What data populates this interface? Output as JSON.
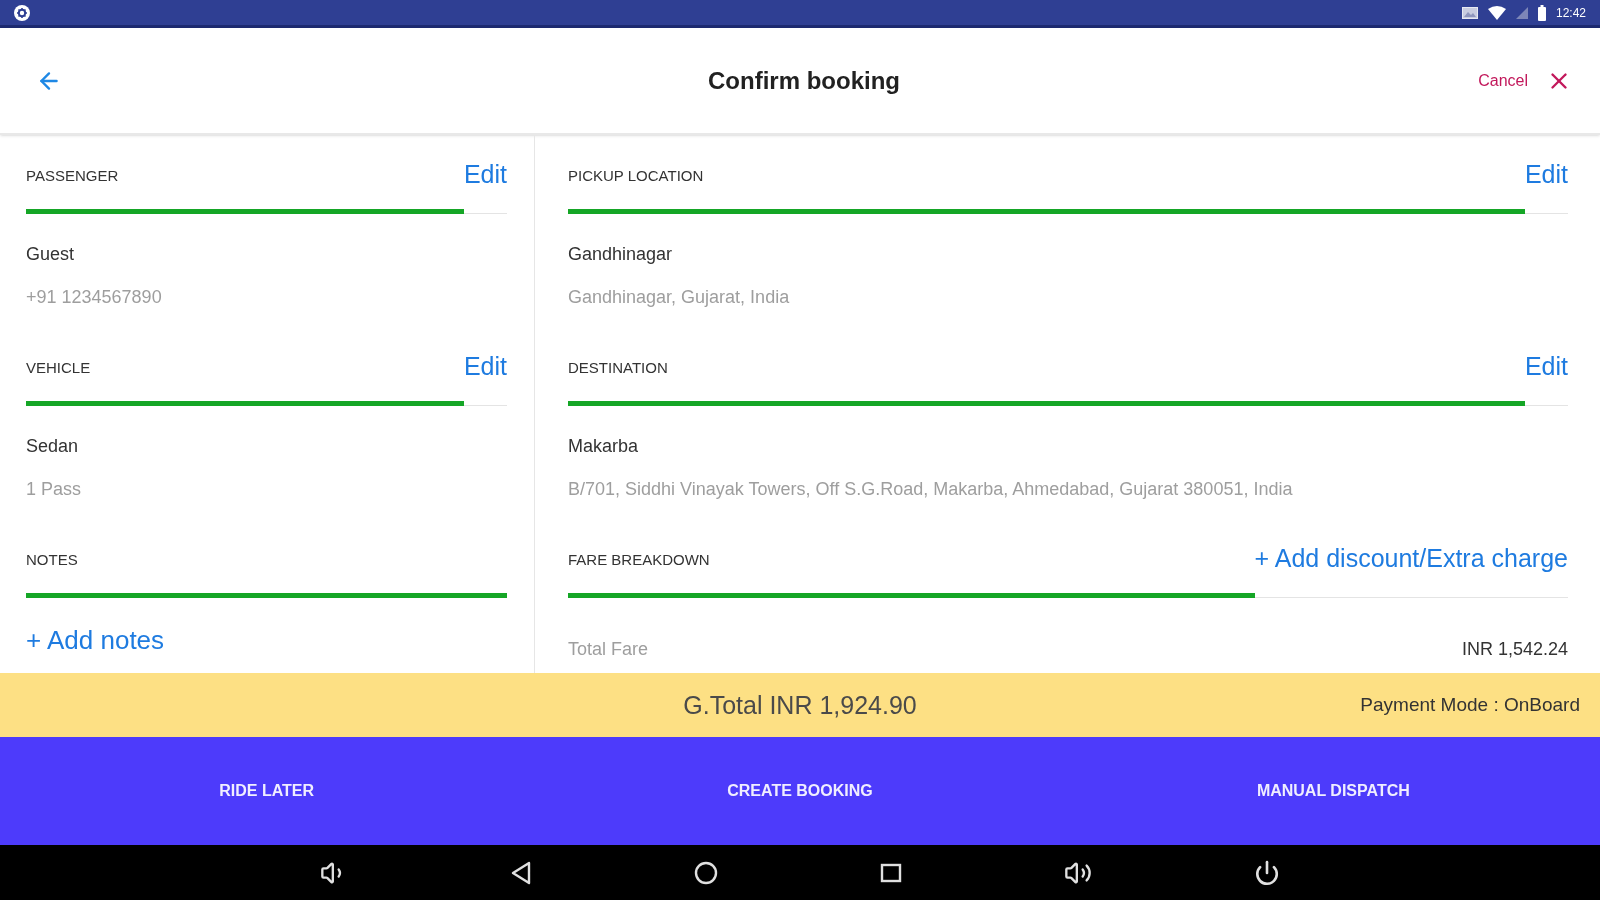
{
  "status_bar": {
    "time": "12:42"
  },
  "header": {
    "title": "Confirm booking",
    "cancel": "Cancel"
  },
  "left_column": {
    "sections": [
      {
        "kind": "detail",
        "label": "PASSENGER",
        "action": "Edit",
        "name": "Guest",
        "detail": "+91 1234567890"
      },
      {
        "kind": "detail",
        "label": "VEHICLE",
        "action": "Edit",
        "name": "Sedan",
        "detail": "1 Pass"
      },
      {
        "kind": "link",
        "label": "NOTES",
        "link": "+ Add notes"
      }
    ]
  },
  "right_column": {
    "sections": [
      {
        "kind": "detail",
        "label": "PICKUP LOCATION",
        "action": "Edit",
        "name": "Gandhinagar",
        "detail": "Gandhinagar, Gujarat, India"
      },
      {
        "kind": "detail",
        "label": "DESTINATION",
        "action": "Edit",
        "name": "Makarba",
        "detail": "B/701, Siddhi Vinayak Towers, Off S.G.Road, Makarba, Ahmedabad, Gujarat 380051, India"
      },
      {
        "kind": "fare",
        "label": "FARE BREAKDOWN",
        "action": "+ Add discount/Extra charge",
        "rows": [
          {
            "label": "Total Fare",
            "value": "INR 1,542.24"
          }
        ]
      }
    ]
  },
  "summary_bar": {
    "grand_total": "G.Total INR 1,924.90",
    "payment_mode": "Payment Mode : OnBoard"
  },
  "action_bar": {
    "buttons": [
      "RIDE LATER",
      "CREATE BOOKING",
      "MANUAL DISPATCH"
    ]
  }
}
